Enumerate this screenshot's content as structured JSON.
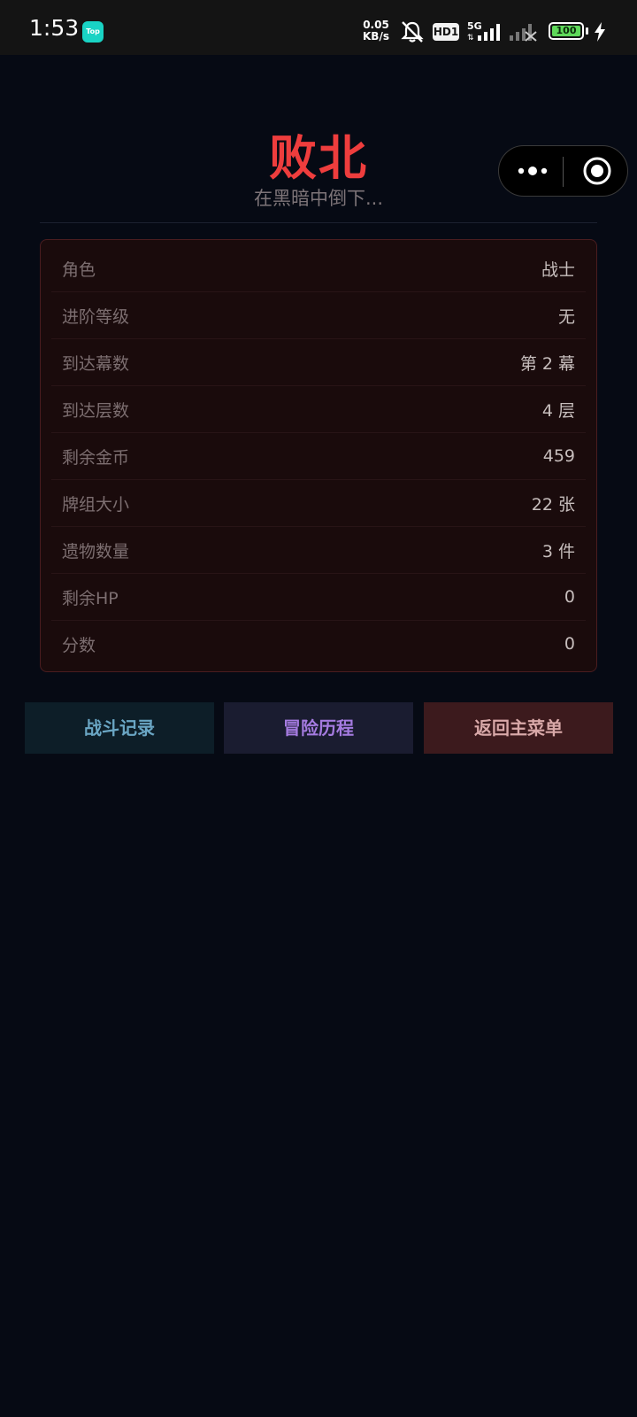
{
  "status_bar": {
    "time": "1:53",
    "app_badge": "Top",
    "net_speed_value": "0.05",
    "net_speed_unit": "KB/s",
    "hd_badge": "HD1",
    "network_type": "5G",
    "battery_level": "100"
  },
  "header": {
    "title": "败北",
    "subtitle": "在黑暗中倒下..."
  },
  "stats": [
    {
      "label": "角色",
      "value": "战士"
    },
    {
      "label": "进阶等级",
      "value": "无"
    },
    {
      "label": "到达幕数",
      "value": "第 2 幕"
    },
    {
      "label": "到达层数",
      "value": "4 层"
    },
    {
      "label": "剩余金币",
      "value": "459"
    },
    {
      "label": "牌组大小",
      "value": "22 张"
    },
    {
      "label": "遗物数量",
      "value": "3 件"
    },
    {
      "label": "剩余HP",
      "value": "0"
    },
    {
      "label": "分数",
      "value": "0"
    }
  ],
  "buttons": {
    "battle_log": "战斗记录",
    "adventure_history": "冒险历程",
    "main_menu": "返回主菜单"
  },
  "colors": {
    "title_red": "#ee3d3d",
    "background": "#060a14",
    "card_bg": "#1a0b0c",
    "battle_log_text": "#6aa6c4",
    "adventure_text": "#a57be0",
    "menu_text": "#d8a8a8"
  },
  "icons": {
    "bell": "bell-muted-icon",
    "signal": "signal-bars-icon",
    "battery": "battery-icon",
    "charging": "lightning-bolt-icon",
    "more": "more-dots-icon",
    "close": "close-circle-icon"
  }
}
